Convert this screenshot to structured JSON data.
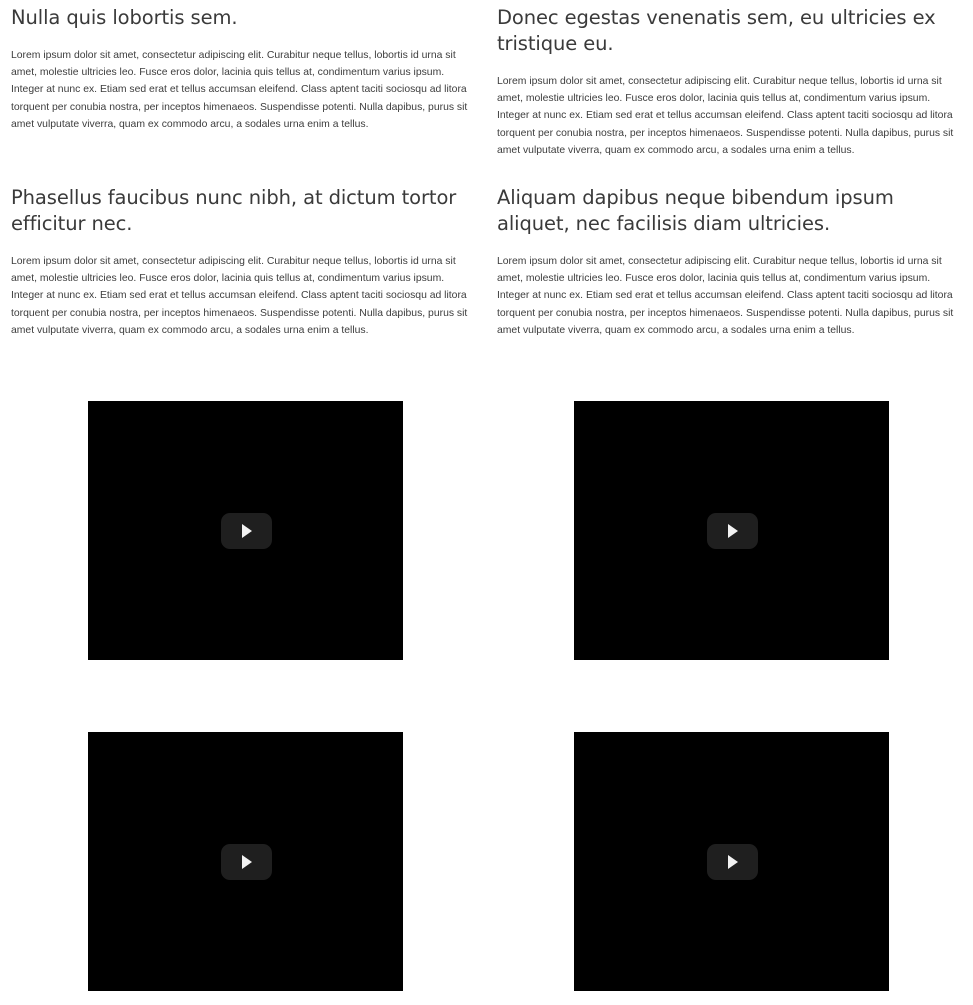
{
  "articles": [
    {
      "title": "Nulla quis lobortis sem.",
      "body": "Lorem ipsum dolor sit amet, consectetur adipiscing elit. Curabitur neque tellus, lobortis id urna sit amet, molestie ultricies leo. Fusce eros dolor, lacinia quis tellus at, condimentum varius ipsum. Integer at nunc ex. Etiam sed erat et tellus accumsan eleifend. Class aptent taciti sociosqu ad litora torquent per conubia nostra, per inceptos himenaeos. Suspendisse potenti. Nulla dapibus, purus sit amet vulputate viverra, quam ex commodo arcu, a sodales urna enim a tellus."
    },
    {
      "title": "Donec egestas venenatis sem, eu ultricies ex tristique eu.",
      "body": "Lorem ipsum dolor sit amet, consectetur adipiscing elit. Curabitur neque tellus, lobortis id urna sit amet, molestie ultricies leo. Fusce eros dolor, lacinia quis tellus at, condimentum varius ipsum. Integer at nunc ex. Etiam sed erat et tellus accumsan eleifend. Class aptent taciti sociosqu ad litora torquent per conubia nostra, per inceptos himenaeos. Suspendisse potenti. Nulla dapibus, purus sit amet vulputate viverra, quam ex commodo arcu, a sodales urna enim a tellus."
    },
    {
      "title": "Phasellus faucibus nunc nibh, at dictum tortor efficitur nec.",
      "body": "Lorem ipsum dolor sit amet, consectetur adipiscing elit. Curabitur neque tellus, lobortis id urna sit amet, molestie ultricies leo. Fusce eros dolor, lacinia quis tellus at, condimentum varius ipsum. Integer at nunc ex. Etiam sed erat et tellus accumsan eleifend. Class aptent taciti sociosqu ad litora torquent per conubia nostra, per inceptos himenaeos. Suspendisse potenti. Nulla dapibus, purus sit amet vulputate viverra, quam ex commodo arcu, a sodales urna enim a tellus."
    },
    {
      "title": "Aliquam dapibus neque bibendum ipsum aliquet, nec facilisis diam ultricies.",
      "body": "Lorem ipsum dolor sit amet, consectetur adipiscing elit. Curabitur neque tellus, lobortis id urna sit amet, molestie ultricies leo. Fusce eros dolor, lacinia quis tellus at, condimentum varius ipsum. Integer at nunc ex. Etiam sed erat et tellus accumsan eleifend. Class aptent taciti sociosqu ad litora torquent per conubia nostra, per inceptos himenaeos. Suspendisse potenti. Nulla dapibus, purus sit amet vulputate viverra, quam ex commodo arcu, a sodales urna enim a tellus."
    }
  ],
  "videos": [
    {
      "icon": "play-icon"
    },
    {
      "icon": "play-icon"
    },
    {
      "icon": "play-icon"
    },
    {
      "icon": "play-icon"
    }
  ],
  "colors": {
    "background": "#ffffff",
    "heading": "#3a3a3a",
    "body_text": "#3d3d3d",
    "video_background": "#000000",
    "play_button": "#212121",
    "play_glyph": "#ffffff"
  }
}
